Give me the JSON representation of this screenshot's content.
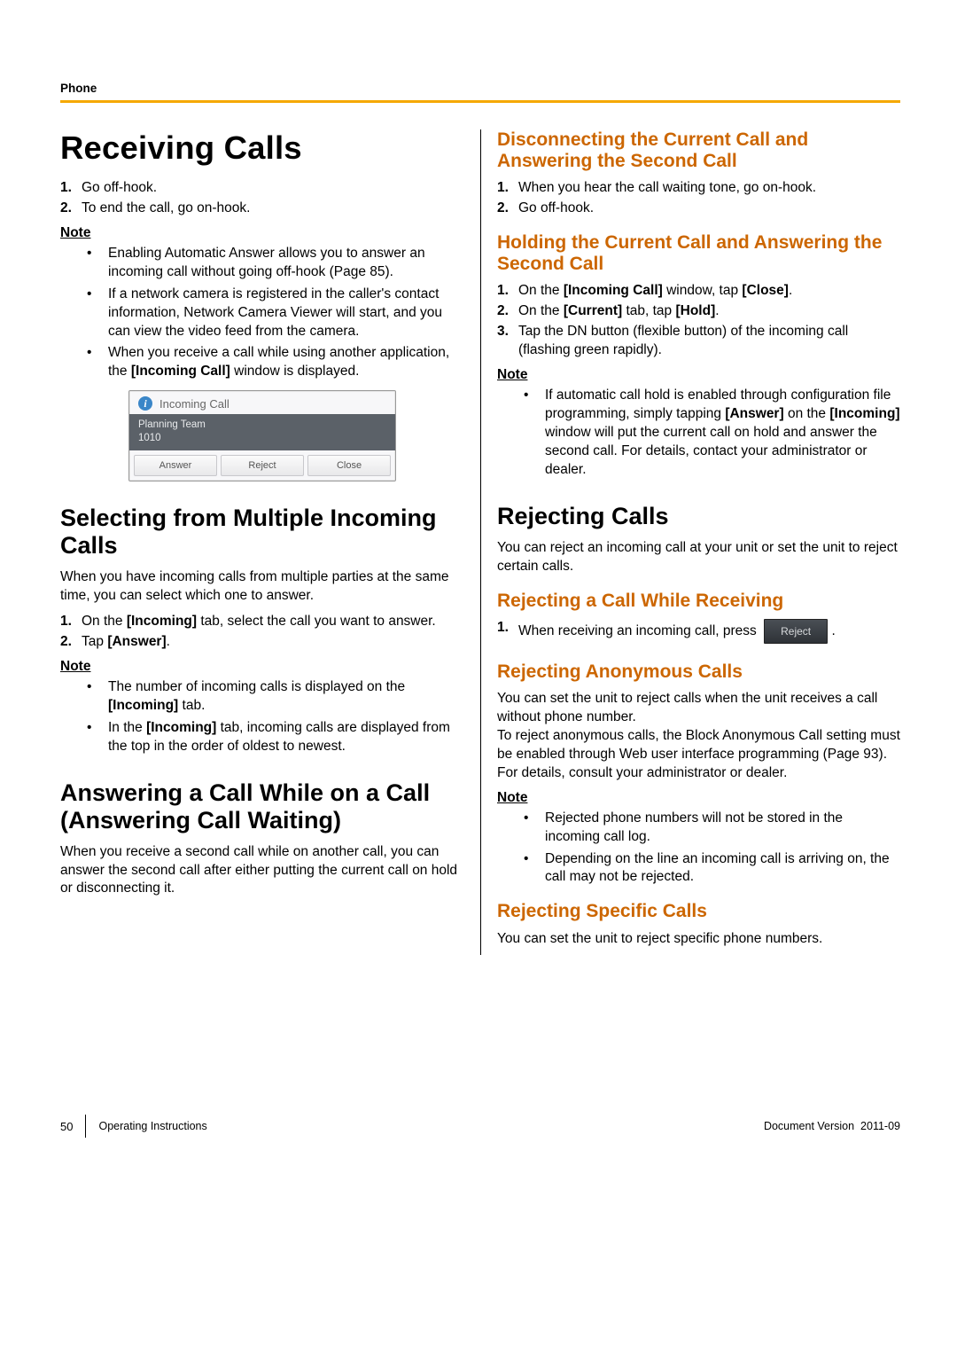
{
  "header": {
    "section": "Phone"
  },
  "left": {
    "h1": "Receiving Calls",
    "steps_top": [
      {
        "n": "1.",
        "t": "Go off-hook."
      },
      {
        "n": "2.",
        "t": "To end the call, go on-hook."
      }
    ],
    "note1_label": "Note",
    "note1_bullets": [
      "Enabling Automatic Answer allows you to answer an incoming call without going off-hook (Page 85).",
      "If a network camera is registered in the caller's contact information, Network Camera Viewer will start, and you can view the video feed from the camera.",
      "When you receive a call while using another application, the [Incoming Call] window is displayed."
    ],
    "popup": {
      "title": "Incoming Call",
      "caller_name": "Planning Team",
      "caller_num": "1010",
      "btn_answer": "Answer",
      "btn_reject": "Reject",
      "btn_close": "Close"
    },
    "h2a": "Selecting from Multiple Incoming Calls",
    "p_multi_intro": "When you have incoming calls from multiple parties at the same time, you can select which one to answer.",
    "steps_multi": [
      {
        "n": "1.",
        "pre": "On the ",
        "b1": "[Incoming]",
        "post": " tab, select the call you want to answer."
      },
      {
        "n": "2.",
        "pre": "Tap ",
        "b1": "[Answer]",
        "post": "."
      }
    ],
    "note2_label": "Note",
    "note2_bullets": [
      {
        "pre": "The number of incoming calls is displayed on the ",
        "b1": "[Incoming]",
        "post": " tab."
      },
      {
        "pre": "In the ",
        "b1": "[Incoming]",
        "post": " tab, incoming calls are displayed from the top in the order of oldest to newest."
      }
    ],
    "h2b": "Answering a Call While on a Call (Answering Call Waiting)",
    "p_waiting": "When you receive a second call while on another call, you can answer the second call after either putting the current call on hold or disconnecting it."
  },
  "right": {
    "h3a": "Disconnecting the Current Call and Answering the Second Call",
    "steps_disc": [
      {
        "n": "1.",
        "t": "When you hear the call waiting tone, go on-hook."
      },
      {
        "n": "2.",
        "t": "Go off-hook."
      }
    ],
    "h3b": "Holding the Current Call and Answering the Second Call",
    "steps_hold": [
      {
        "n": "1.",
        "pre": "On the ",
        "b1": "[Incoming Call]",
        "mid": " window, tap ",
        "b2": "[Close]",
        "post": "."
      },
      {
        "n": "2.",
        "pre": "On the ",
        "b1": "[Current]",
        "mid": " tab, tap ",
        "b2": "[Hold]",
        "post": "."
      },
      {
        "n": "3.",
        "pre": "Tap the DN button (flexible button) of the incoming call (flashing green rapidly).",
        "b1": "",
        "mid": "",
        "b2": "",
        "post": ""
      }
    ],
    "note3_label": "Note",
    "note3_bullet": {
      "pre": "If automatic call hold is enabled through configuration file programming, simply tapping ",
      "b1": "[Answer]",
      "mid": " on the ",
      "b2": "[Incoming]",
      "post": " window will put the current call on hold and answer the second call. For details, contact your administrator or dealer."
    },
    "h2c": "Rejecting Calls",
    "p_reject_intro": "You can reject an incoming call at your unit or set the unit to reject certain calls.",
    "h3c": "Rejecting a Call While Receiving",
    "step_rej_press": {
      "n": "1.",
      "pre": "When receiving an incoming call, press",
      "btn": "Reject",
      "post": "."
    },
    "h3d": "Rejecting Anonymous Calls",
    "p_anon1": "You can set the unit to reject calls when the unit receives a call without phone number.",
    "p_anon2": "To reject anonymous calls, the Block Anonymous Call setting must be enabled through Web user interface programming (Page 93). For details, consult your administrator or dealer.",
    "note4_label": "Note",
    "note4_bullets": [
      "Rejected phone numbers will not be stored in the incoming call log.",
      "Depending on the line an incoming call is arriving on, the call may not be rejected."
    ],
    "h3e": "Rejecting Specific Calls",
    "p_spec": "You can set the unit to reject specific phone numbers."
  },
  "footer": {
    "page": "50",
    "doc": "Operating Instructions",
    "ver_label": "Document Version",
    "ver_value": "2011-09"
  }
}
